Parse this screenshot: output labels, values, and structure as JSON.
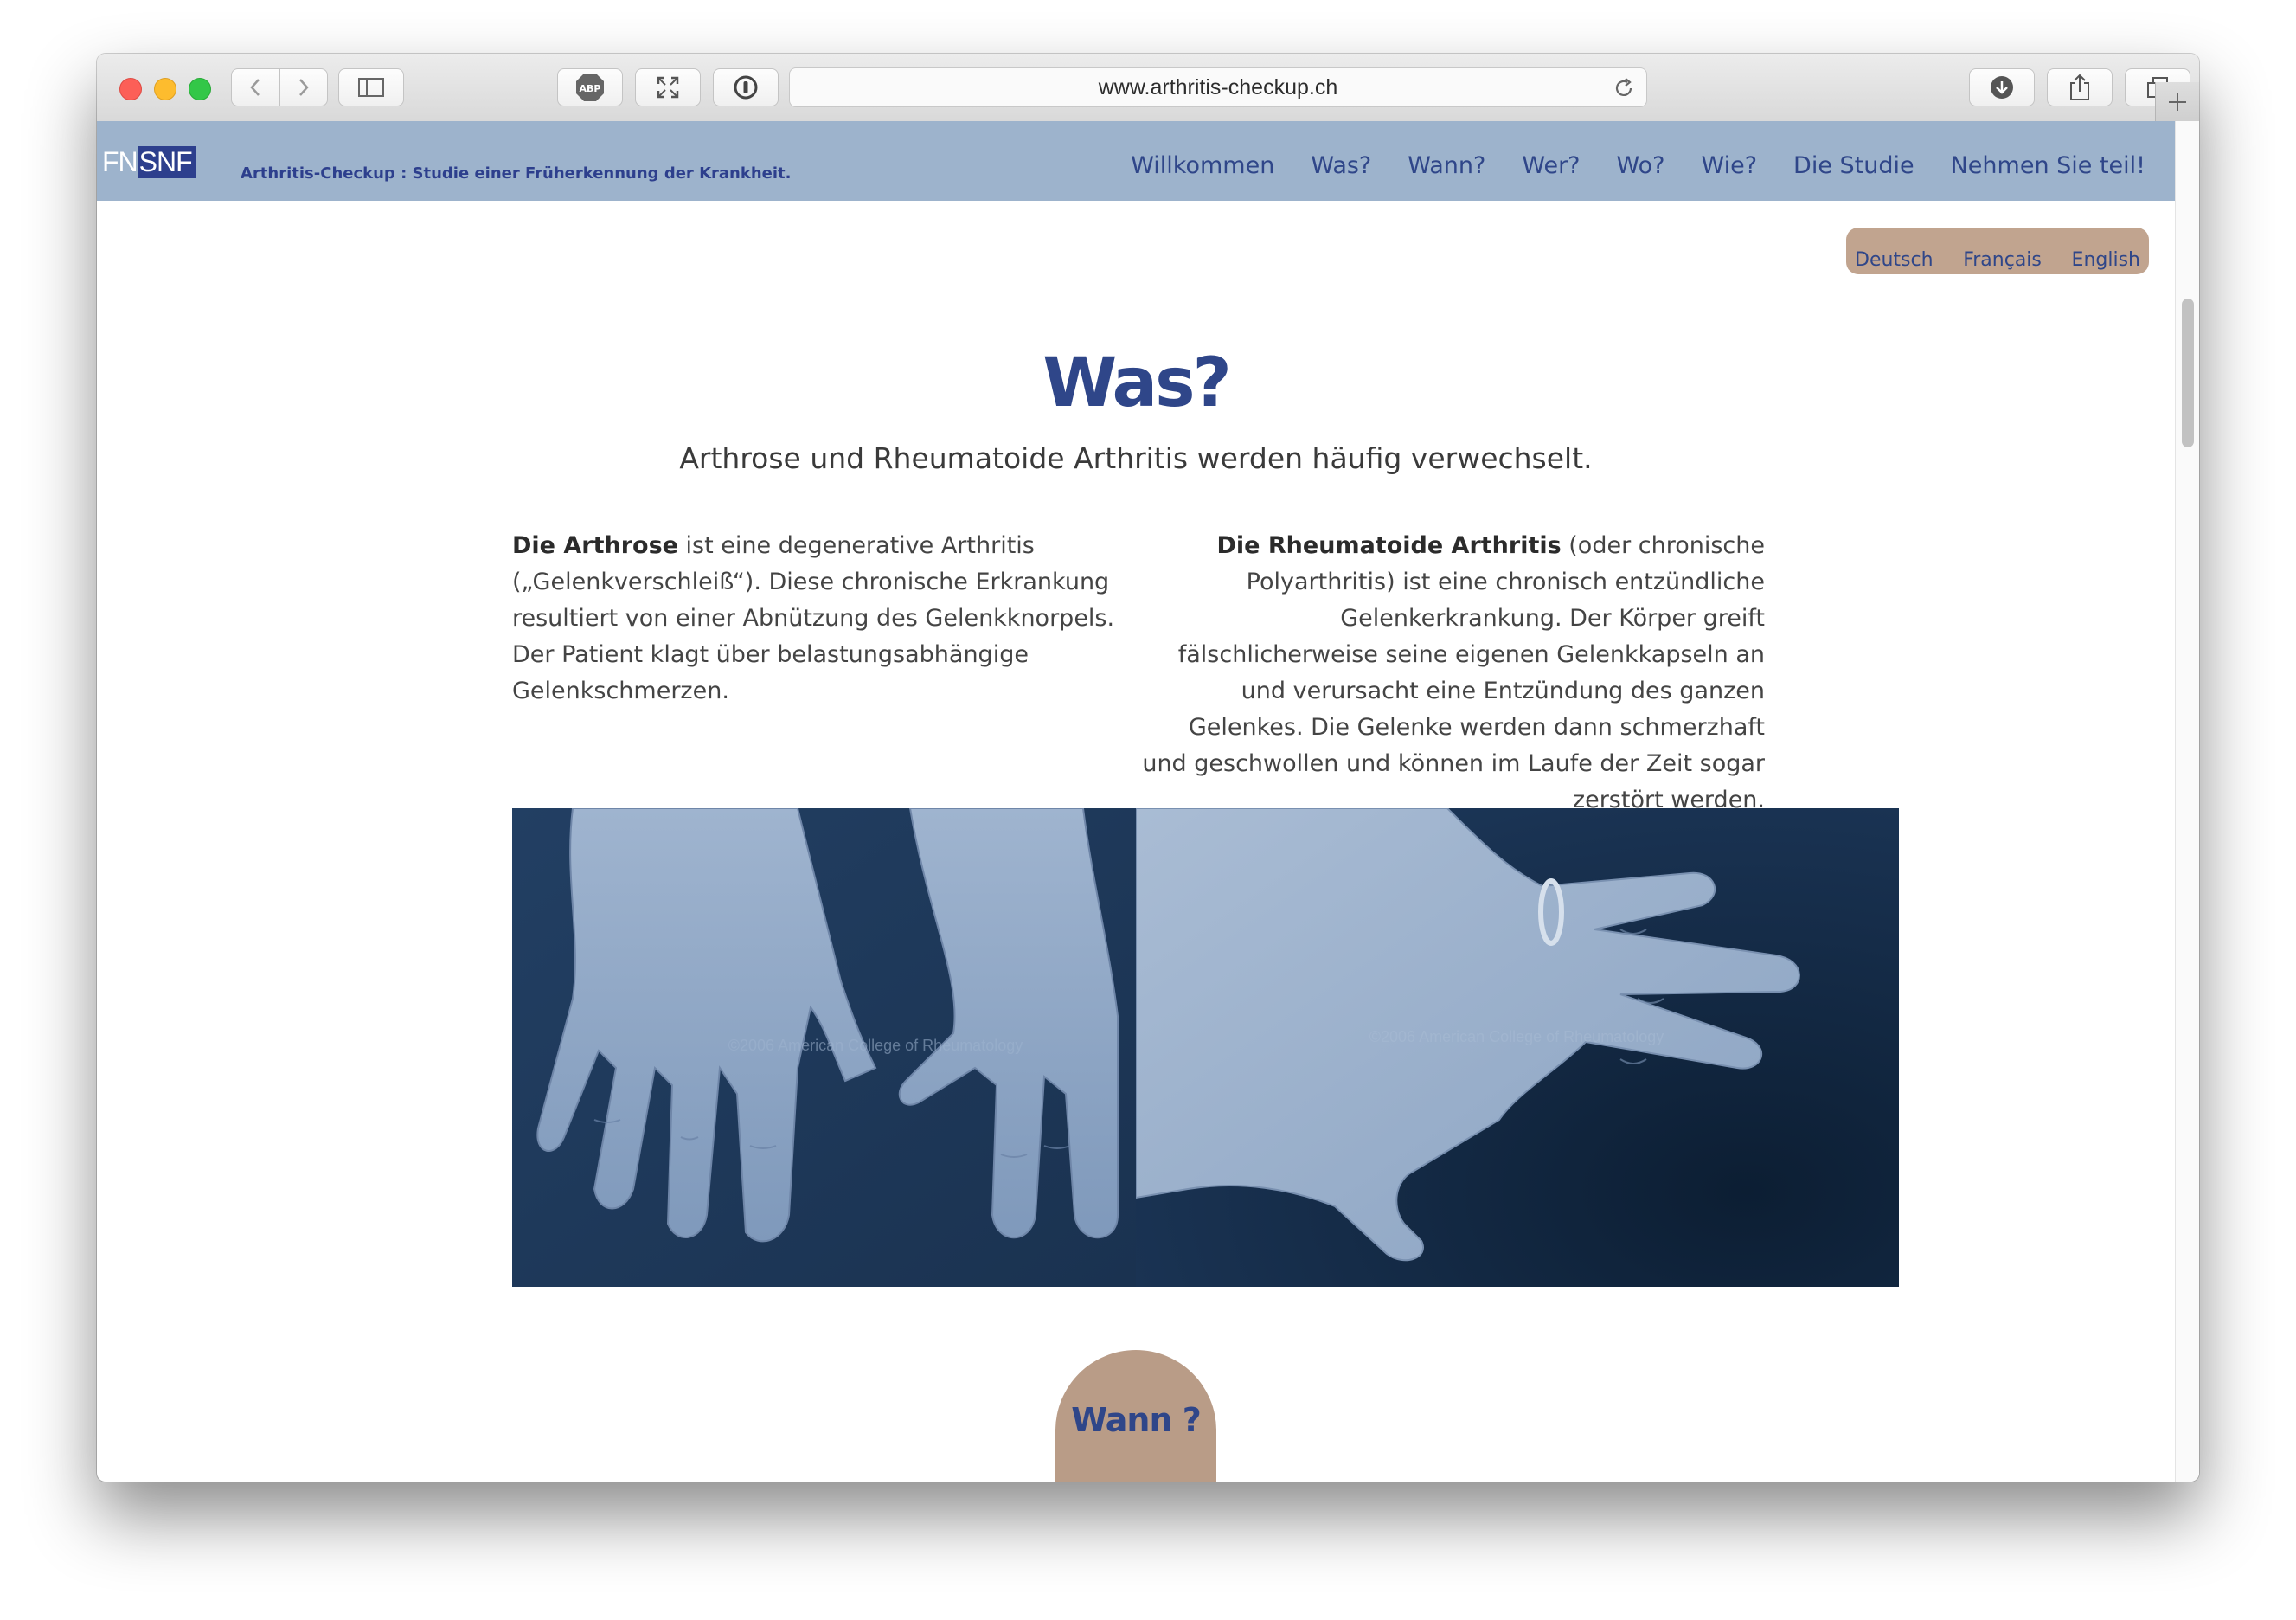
{
  "browser": {
    "url": "www.arthritis-checkup.ch",
    "abp_label": "ABP"
  },
  "site": {
    "logo_fn": "FN",
    "logo_snf": "SNF",
    "tagline": "Arthritis-Checkup : Studie einer Früherkennung der Krankheit.",
    "nav": [
      "Willkommen",
      "Was?",
      "Wann?",
      "Wer?",
      "Wo?",
      "Wie?",
      "Die Studie",
      "Nehmen Sie teil!"
    ],
    "languages": [
      "Deutsch",
      "Français",
      "English"
    ]
  },
  "content": {
    "title": "Was?",
    "subtitle": "Arthrose und Rheumatoide Arthritis werden häufig verwechselt.",
    "left": {
      "term": "Die Arthrose",
      "text": " ist eine degenerative Arthritis („Gelenkverschleiß“). Diese chronische Erkrankung resultiert von einer Abnützung des Gelenkknorpels. Der Patient klagt über belastungsabhängige Gelenkschmerzen."
    },
    "right": {
      "term": "Die Rheumatoide Arthritis",
      "text": " (oder chronische Polyarthritis) ist eine chronisch entzündliche Gelenkerkrankung. Der Körper greift fälschlicherweise seine eigenen Gelenkkapseln an und verursacht eine Entzündung des ganzen Gelenkes. Die Gelenke werden dann schmerzhaft und geschwollen und können im Laufe der Zeit sogar zerstört werden."
    },
    "images": {
      "left_watermark": "©2006 American College of Rheumatology",
      "right_watermark": "©2006 American College of Rheumatology"
    },
    "next_label": "Wann ?"
  },
  "colors": {
    "header_bg": "#9db3cc",
    "brand_blue": "#2f4689",
    "tab_tan": "#c1a48f"
  }
}
